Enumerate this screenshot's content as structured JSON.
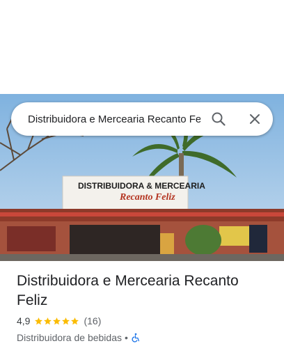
{
  "search": {
    "query": "Distribuidora e Mercearia Recanto Feliz"
  },
  "photo": {
    "sign_line1": "DISTRIBUIDORA & MERCEARIA",
    "sign_line2": "Recanto Feliz"
  },
  "place": {
    "name": "Distribuidora e Mercearia Recanto Feliz",
    "rating": "4,9",
    "star_count": 5,
    "reviews": "(16)",
    "category": "Distribuidora de bebidas",
    "separator": "•"
  },
  "colors": {
    "star": "#fbbc04",
    "accessible": "#1a73e8",
    "text": "#202124"
  }
}
